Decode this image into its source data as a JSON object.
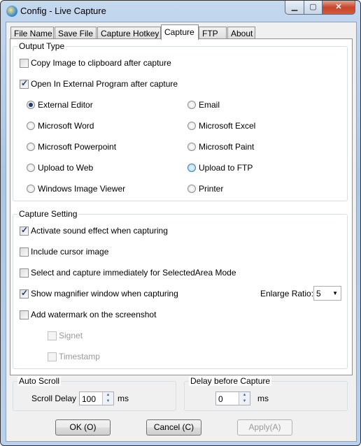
{
  "window": {
    "title": "Config - Live Capture",
    "minimize": "▁",
    "maximize": "▢",
    "close": "✕"
  },
  "tabs": [
    {
      "label": "File Name"
    },
    {
      "label": "Save File"
    },
    {
      "label": "Capture Hotkey"
    },
    {
      "label": "Capture",
      "active": true
    },
    {
      "label": "FTP"
    },
    {
      "label": "About"
    }
  ],
  "output_type": {
    "title": "Output Type",
    "copy_clipboard": {
      "label": "Copy Image to clipboard after capture",
      "checked": false
    },
    "open_external": {
      "label": "Open In External Program after capture",
      "checked": true
    },
    "options": [
      {
        "label": "External Editor",
        "selected": true
      },
      {
        "label": "Email"
      },
      {
        "label": "Microsoft Word"
      },
      {
        "label": "Microsoft Excel"
      },
      {
        "label": "Microsoft Powerpoint"
      },
      {
        "label": "Microsoft Paint"
      },
      {
        "label": "Upload to Web"
      },
      {
        "label": "Upload to FTP"
      },
      {
        "label": "Windows Image Viewer"
      },
      {
        "label": "Printer"
      }
    ]
  },
  "capture_setting": {
    "title": "Capture Setting",
    "items": [
      {
        "label": "Activate sound effect when capturing",
        "checked": true
      },
      {
        "label": "Include cursor image",
        "checked": false
      },
      {
        "label": "Select and capture immediately for SelectedArea Mode",
        "checked": false
      },
      {
        "label": "Show magnifier window when capturing",
        "checked": true
      },
      {
        "label": "Add watermark on the screenshot",
        "checked": false
      }
    ],
    "signet": {
      "label": "Signet",
      "checked": false,
      "disabled": true
    },
    "timestamp": {
      "label": "Timestamp",
      "checked": false,
      "disabled": true
    },
    "enlarge_ratio": {
      "label": "Enlarge Ratio:",
      "value": "5"
    }
  },
  "auto_scroll": {
    "title": "Auto Scroll",
    "label": "Scroll Delay",
    "value": "100",
    "unit": "ms"
  },
  "delay": {
    "title": "Delay before Capture",
    "value": "0",
    "unit": "ms"
  },
  "buttons": {
    "ok": "OK (O)",
    "cancel": "Cancel (C)",
    "apply": "Apply(A)"
  }
}
